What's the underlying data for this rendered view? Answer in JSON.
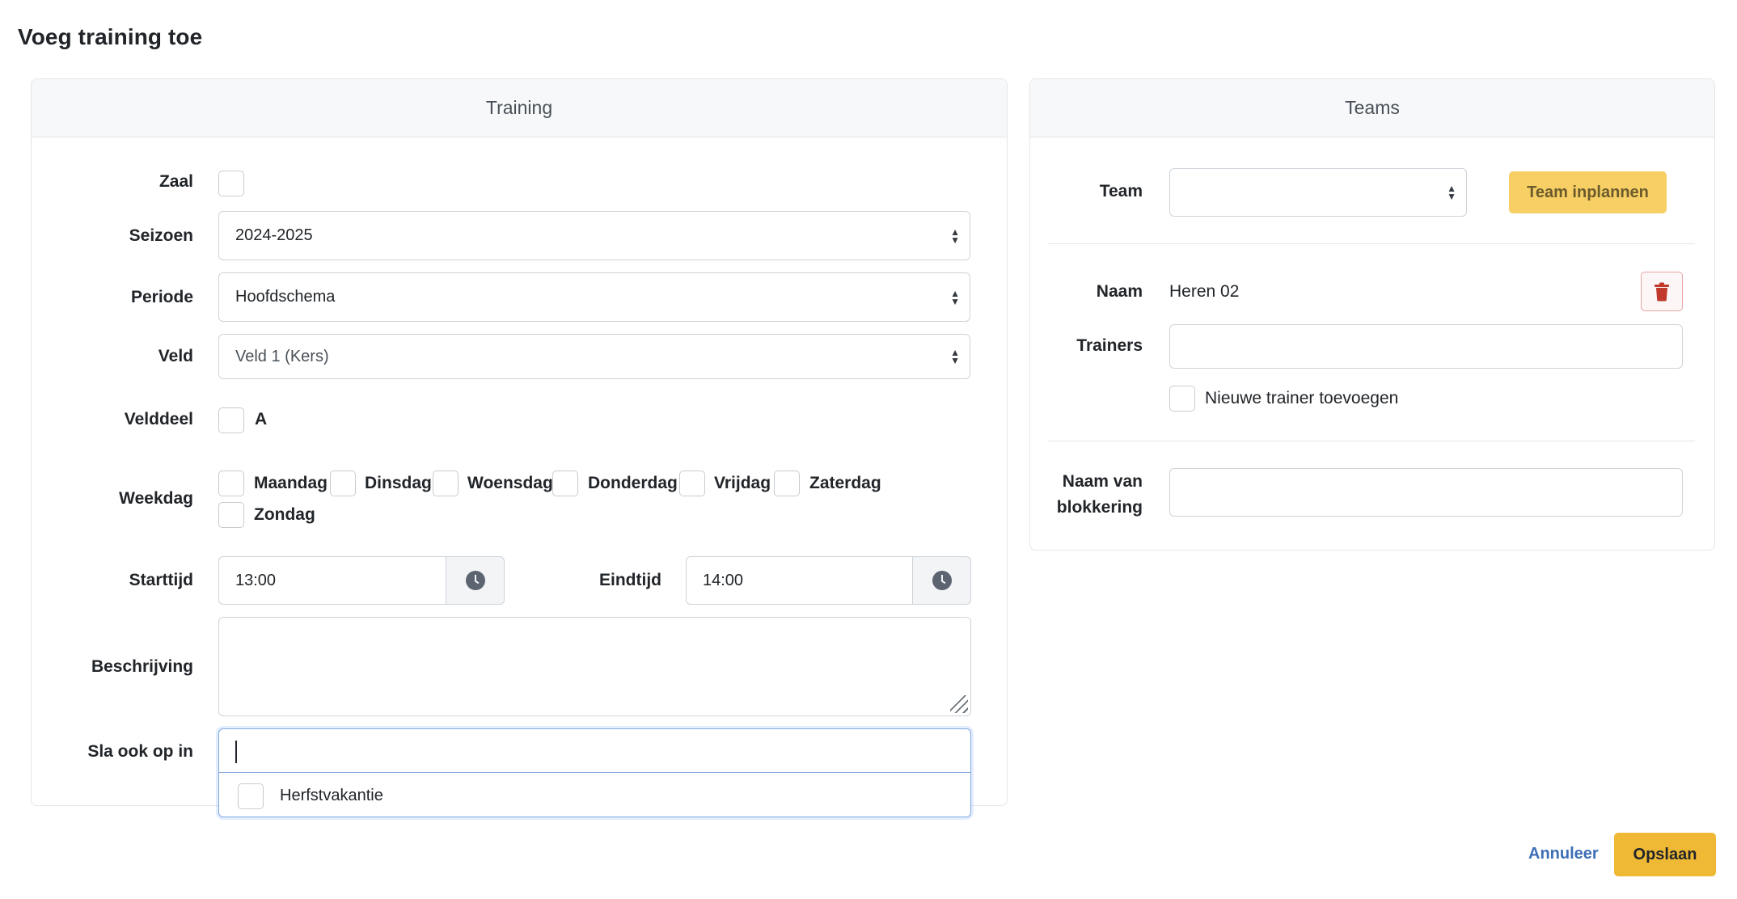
{
  "page": {
    "title": "Voeg training toe"
  },
  "training": {
    "header": "Training",
    "zaal_label": "Zaal",
    "seizoen_label": "Seizoen",
    "seizoen_value": "2024-2025",
    "periode_label": "Periode",
    "periode_value": "Hoofdschema",
    "veld_label": "Veld",
    "veld_value": "Veld 1 (Kers)",
    "velddeel_label": "Velddeel",
    "velddeel_option": "A",
    "weekdag_label": "Weekdag",
    "weekdagen": [
      "Maandag",
      "Dinsdag",
      "Woensdag",
      "Donderdag",
      "Vrijdag",
      "Zaterdag",
      "Zondag"
    ],
    "starttijd_label": "Starttijd",
    "starttijd_value": "13:00",
    "eindtijd_label": "Eindtijd",
    "eindtijd_value": "14:00",
    "beschrijving_label": "Beschrijving",
    "sla_ook_op_label": "Sla ook op in",
    "sla_ook_op_options": [
      "Herfstvakantie"
    ]
  },
  "teams": {
    "header": "Teams",
    "team_label": "Team",
    "team_value": "",
    "team_inplannen_label": "Team inplannen",
    "naam_label": "Naam",
    "naam_value": "Heren 02",
    "trainers_label": "Trainers",
    "nieuwe_trainer_label": "Nieuwe trainer toevoegen",
    "blokkering_label_line1": "Naam van",
    "blokkering_label_line2": "blokkering"
  },
  "footer": {
    "cancel_label": "Annuleer",
    "save_label": "Opslaan"
  },
  "icons": {
    "clock": "clock-icon",
    "trash": "trash-icon",
    "select_arrows": "chevron-up-down-icon"
  },
  "colors": {
    "accent_yellow": "#f0b935",
    "delete_red": "#c0392b",
    "link_blue": "#3d6fb5"
  }
}
